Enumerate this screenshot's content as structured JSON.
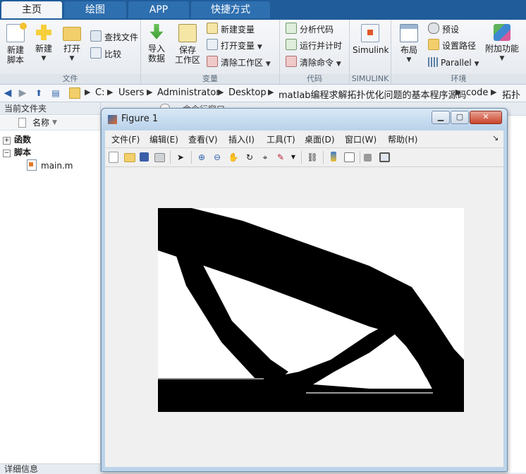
{
  "ribbon": {
    "tabs": [
      "主页",
      "绘图",
      "APP",
      "快捷方式"
    ],
    "groups": {
      "file": {
        "label": "文件",
        "new_script": "新建\n脚本",
        "new": "新建",
        "open": "打开",
        "find_files": "查找文件",
        "compare": "比较"
      },
      "variable": {
        "label": "变量",
        "import_data": "导入\n数据",
        "save_workspace": "保存\n工作区",
        "new_variable": "新建变量",
        "open_variable": "打开变量",
        "clear_workspace": "清除工作区"
      },
      "code": {
        "label": "代码",
        "analyze_code": "分析代码",
        "run_and_time": "运行并计时",
        "clear_commands": "清除命令"
      },
      "simulink": {
        "label": "SIMULINK",
        "simulink": "Simulink"
      },
      "environment": {
        "label": "环境",
        "layout": "布局",
        "preferences": "预设",
        "set_path": "设置路径",
        "parallel": "Parallel",
        "addons": "附加功能"
      }
    }
  },
  "address": {
    "crumbs": [
      "C:",
      "Users",
      "Administrator",
      "Desktop",
      "matlab编程求解拓扑优化问题的基本程序源码",
      "code",
      "拓扑"
    ]
  },
  "left_panel": {
    "title": "当前文件夹",
    "column_header": "名称",
    "tree": [
      {
        "label": "函数",
        "expander": "+"
      },
      {
        "label": "脚本",
        "expander": "−"
      },
      {
        "label": "main.m"
      }
    ],
    "details": "详细信息"
  },
  "command_window": {
    "title": "命令行窗口"
  },
  "figure": {
    "title": "Figure 1",
    "menu": [
      "文件(F)",
      "编辑(E)",
      "查看(V)",
      "插入(I)",
      "工具(T)",
      "桌面(D)",
      "窗口(W)",
      "帮助(H)"
    ]
  }
}
